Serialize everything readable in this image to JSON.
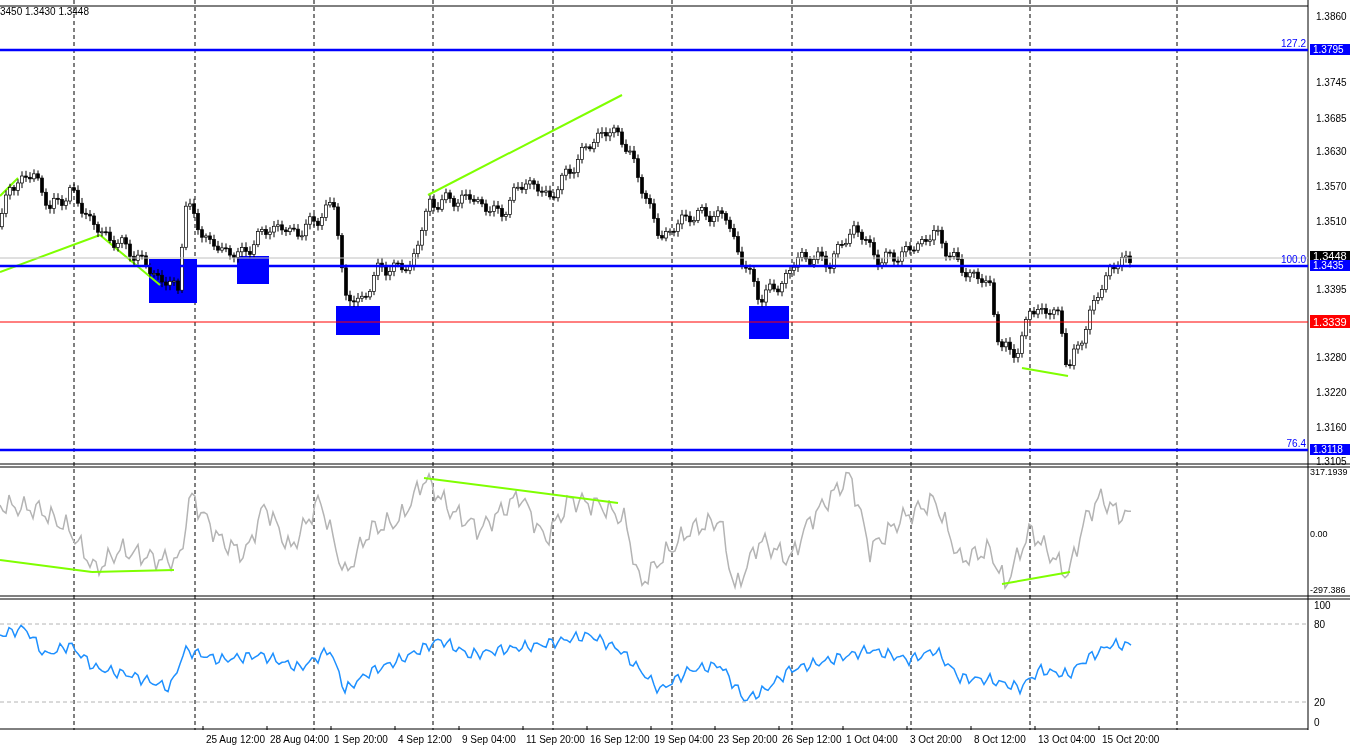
{
  "header": {
    "ohlc_text": "3450 1.3430 1.3448"
  },
  "price_panel": {
    "y_axis_labels": [
      "1.3860",
      "1.3745",
      "1.3685",
      "1.3630",
      "1.3570",
      "1.3510",
      "1.3395",
      "1.3280",
      "1.3220",
      "1.3160",
      "1.3105"
    ],
    "levels": [
      {
        "kind": "fib",
        "ratio": "127.2",
        "tag": "1.3795"
      },
      {
        "kind": "bid",
        "tag": "1.3448"
      },
      {
        "kind": "fib",
        "ratio": "100.0",
        "tag": "1.3435"
      },
      {
        "kind": "resistance",
        "tag": "1.3339"
      },
      {
        "kind": "fib",
        "ratio": "76.4",
        "tag": "1.3118"
      }
    ]
  },
  "cci_panel": {
    "y_axis_labels": [
      "317.1939",
      "0.00",
      "-297.386"
    ]
  },
  "stochastic_panel": {
    "y_axis_labels": [
      "100",
      "80",
      "20",
      "0"
    ]
  },
  "time_axis": {
    "labels": [
      "25 Aug 12:00",
      "28 Aug 04:00",
      "1 Sep 20:00",
      "4 Sep 12:00",
      "9 Sep 04:00",
      "11 Sep 20:00",
      "16 Sep 12:00",
      "19 Sep 04:00",
      "23 Sep 20:00",
      "26 Sep 12:00",
      "1 Oct 04:00",
      "3 Oct 20:00",
      "8 Oct 12:00",
      "13 Oct 04:00",
      "15 Oct 20:00"
    ]
  }
}
